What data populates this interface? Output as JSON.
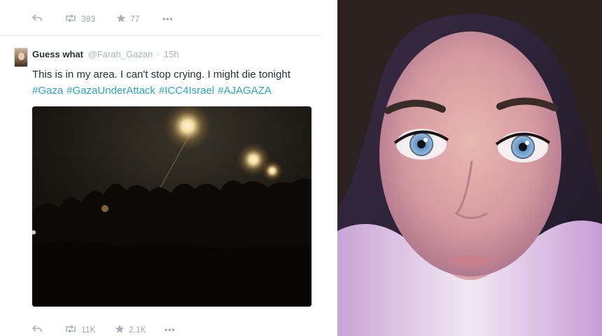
{
  "tweet_top_actions": {
    "reply_icon": "reply-icon",
    "retweet_icon": "retweet-icon",
    "retweet_count": "393",
    "favorite_icon": "star-icon",
    "favorite_count": "77",
    "more_icon": "more-icon",
    "more_label": "•••"
  },
  "tweet": {
    "display_name": "Guess what",
    "handle": "@Farah_Gazan",
    "separator": "·",
    "time": "15h",
    "text": "This is in my area. I can't stop crying. I might die tonight",
    "hashtags": [
      "#Gaza",
      "#GazaUnderAttack",
      "#ICC4Israel",
      "#AJAGAZA"
    ],
    "link_color": "#2aa3c4",
    "media_description_icon": "photo-night-flares"
  },
  "tweet_bottom_actions": {
    "reply_icon": "reply-icon",
    "retweet_icon": "retweet-icon",
    "retweet_count": "11K",
    "favorite_icon": "star-icon",
    "favorite_count": "2.1K",
    "more_icon": "more-icon",
    "more_label": "•••"
  },
  "colors": {
    "action_gray": "#a0a7ad",
    "text_dark": "#292f33",
    "handle_gray": "#aab3ba"
  }
}
